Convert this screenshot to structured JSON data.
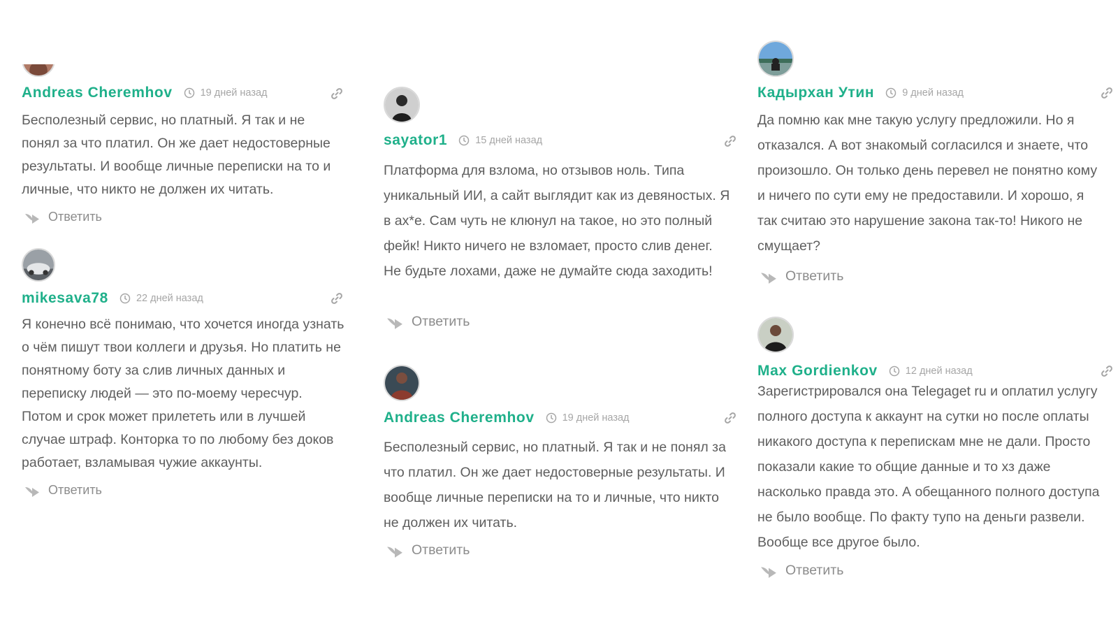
{
  "reply_label": "Ответить",
  "colors": {
    "author": "#1fb08a",
    "text": "#5e5e5e",
    "meta": "#a6a6a6"
  },
  "comments": [
    {
      "author": "Andreas Cheremhov",
      "time": "19 дней назад",
      "text": "Бесполезный сервис, но платный. Я так и не понял за что платил. Он же дает недостоверные результаты. И вообще личные переписки на то и личные, что никто не должен их читать."
    },
    {
      "author": "mikesava78",
      "time": "22 дней назад",
      "text": "Я конечно всё понимаю, что хочется иногда узнать о чём пишут твои коллеги и друзья. Но платить не понятному боту за слив личных данных и переписку людей — это по-моему чересчур. Потом и срок может прилететь или в лучшей случае штраф. Конторка то по любому без доков работает, взламывая чужие аккаунты."
    },
    {
      "author": "sayator1",
      "time": "15 дней назад",
      "text": "Платформа для взлома, но отзывов ноль. Типа уникальный ИИ, а сайт выглядит как из девяностых. Я в ах*е. Сам чуть не клюнул на такое, но это полный фейк! Никто ничего не взломает, просто слив денег. Не будьте лохами, даже не думайте сюда заходить!"
    },
    {
      "author": "Andreas Cheremhov",
      "time": "19 дней назад",
      "text": "Бесполезный сервис, но платный. Я так и не понял за что платил. Он же дает недостоверные результаты. И вообще личные переписки на то и личные, что никто не должен их читать."
    },
    {
      "author": "Кадырхан Утин",
      "time": "9 дней назад",
      "text": "Да помню как мне такую услугу предложили. Но я отказался. А вот знакомый согласился и знаете, что произошло. Он только день перевел не понятно кому и ничего по сути ему не предоставили. И хорошо, я так считаю это нарушение закона так-то! Никого не смущает?"
    },
    {
      "author": "Max Gordienkov",
      "time": "12 дней назад",
      "text": "Зарегистрировался она Telegaget ru и оплатил услугу полного доступа к аккаунт на сутки но после оплаты никакого доступа к перепискам мне не дали. Просто показали какие то общие данные и то хз даже насколько правда это. А обещанного полного доступа не было вообще. По факту тупо на деньги развели. Вообще все другое было."
    }
  ]
}
